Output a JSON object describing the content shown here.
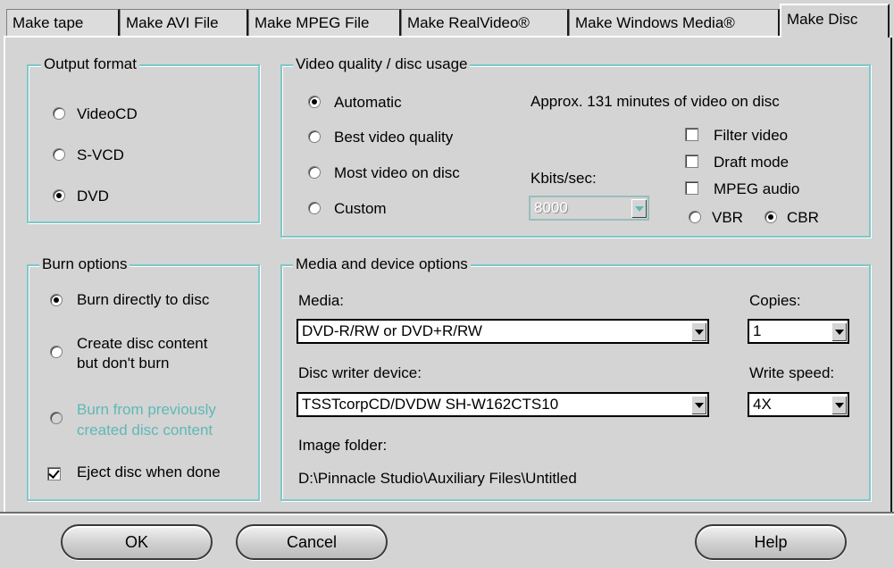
{
  "tabs": [
    {
      "label": "Make tape",
      "active": false
    },
    {
      "label": "Make AVI File",
      "active": false
    },
    {
      "label": "Make MPEG File",
      "active": false
    },
    {
      "label": "Make RealVideo®",
      "active": false
    },
    {
      "label": "Make Windows Media®",
      "active": false
    },
    {
      "label": "Make Disc",
      "active": true
    }
  ],
  "output_format": {
    "legend": "Output format",
    "options": [
      "VideoCD",
      "S-VCD",
      "DVD"
    ],
    "selected": "DVD"
  },
  "video_quality": {
    "legend": "Video quality / disc usage",
    "options": [
      "Automatic",
      "Best video quality",
      "Most video on disc",
      "Custom"
    ],
    "selected": "Automatic",
    "approx_text": "Approx. 131 minutes of video on disc",
    "kbits_label": "Kbits/sec:",
    "kbits_value": "8000",
    "filter_video": {
      "label": "Filter video",
      "checked": false
    },
    "draft_mode": {
      "label": "Draft mode",
      "checked": false
    },
    "mpeg_audio": {
      "label": "MPEG audio",
      "checked": false
    },
    "vbr_label": "VBR",
    "cbr_label": "CBR",
    "rate_mode": "CBR"
  },
  "burn_options": {
    "legend": "Burn options",
    "burn_directly": "Burn directly to disc",
    "create_content_line1": "Create disc content",
    "create_content_line2": "but don't burn",
    "burn_previous_line1": "Burn from previously",
    "burn_previous_line2": "created disc content",
    "selected": "Burn directly to disc",
    "eject": {
      "label": "Eject disc when done",
      "checked": true
    }
  },
  "media_device": {
    "legend": "Media and device options",
    "media_label": "Media:",
    "media_value": "DVD-R/RW or DVD+R/RW",
    "copies_label": "Copies:",
    "copies_value": "1",
    "writer_label": "Disc writer device:",
    "writer_value": "TSSTcorpCD/DVDW SH-W162CTS10",
    "speed_label": "Write speed:",
    "speed_value": "4X",
    "image_folder_label": "Image folder:",
    "image_folder_value": "D:\\Pinnacle Studio\\Auxiliary Files\\Untitled"
  },
  "buttons": {
    "ok": "OK",
    "cancel": "Cancel",
    "help": "Help"
  }
}
